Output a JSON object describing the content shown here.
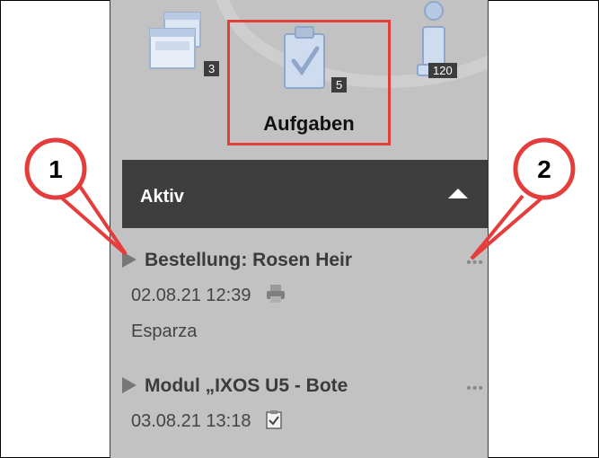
{
  "tabs": [
    {
      "name": "windows",
      "badge": "3"
    },
    {
      "name": "tasks",
      "badge": "5",
      "label": "Aufgaben"
    },
    {
      "name": "info",
      "badge": "120"
    }
  ],
  "section": {
    "title": "Aktiv"
  },
  "tasks": [
    {
      "title": "Bestellung: Rosen Heir",
      "date": "02.08.21 12:39",
      "user": "Esparza",
      "icon": "printer-icon"
    },
    {
      "title": "Modul „IXOS U5 - Bote",
      "date": "03.08.21 13:18",
      "icon": "task-icon"
    }
  ],
  "callouts": [
    "1",
    "2"
  ],
  "colors": {
    "panel": "#c2c2c2",
    "header": "#3e3e3e",
    "highlight": "#e53c3c",
    "callout": "#e53c3c"
  }
}
